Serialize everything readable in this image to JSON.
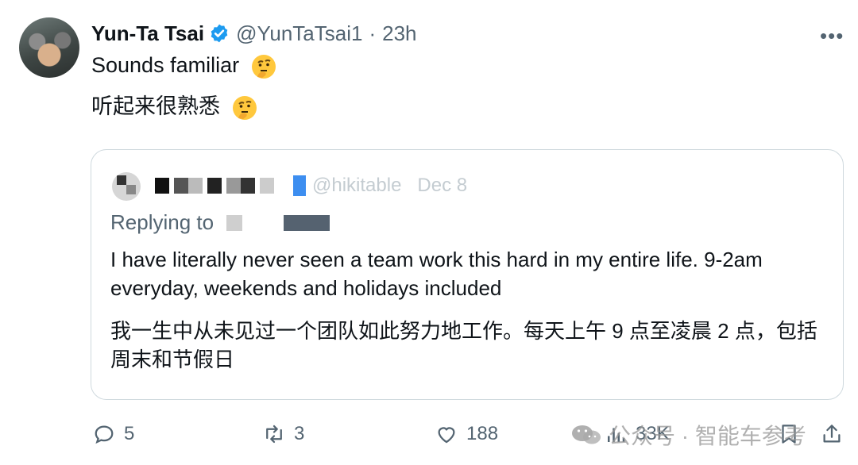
{
  "tweet": {
    "author_name": "Yun-Ta Tsai",
    "author_handle": "@YunTaTsai1",
    "separator": "·",
    "time": "23h",
    "more_label": "•••",
    "text_en": "Sounds familiar",
    "text_cn": "听起来很熟悉",
    "emoji": "thinking-face"
  },
  "quote": {
    "handle": "@hikitable",
    "time": "Dec 8",
    "replying_label": "Replying to",
    "text_en": "I have literally never seen a team work this hard in my entire life. 9-2am everyday, weekends and holidays included",
    "text_cn": "我一生中从未见过一个团队如此努力地工作。每天上午 9 点至凌晨 2 点，包括周末和节假日"
  },
  "actions": {
    "replies": "5",
    "retweets": "3",
    "likes": "188",
    "views": "33K"
  },
  "watermark": {
    "text": "公众号 · 智能车参考"
  },
  "colors": {
    "text": "#0f1419",
    "secondary": "#536471",
    "verified": "#1d9bf0",
    "border": "#cfd9de"
  }
}
